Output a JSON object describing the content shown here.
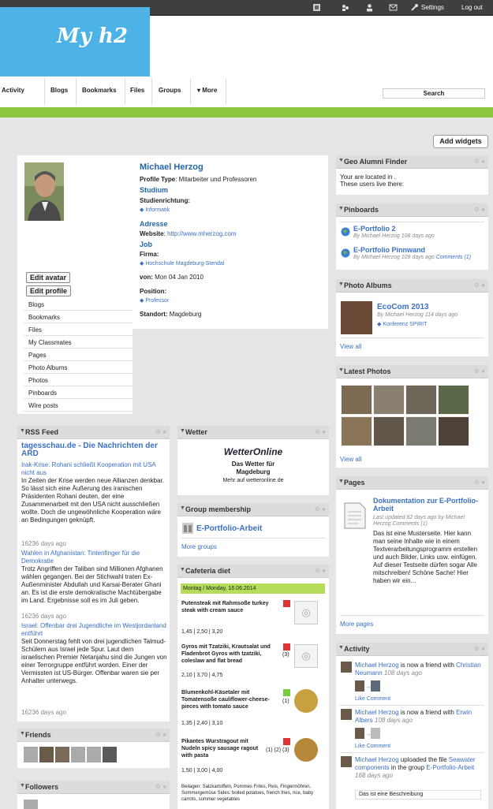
{
  "topbar": {
    "settings": "Settings",
    "logout": "Log out",
    "icons": [
      "dashboard-icon",
      "friends-icon",
      "profile-icon",
      "messages-icon",
      "settings-icon"
    ]
  },
  "logo": "My h2",
  "nav": {
    "items": [
      "Activity",
      "Blogs",
      "Bookmarks",
      "Files",
      "Groups",
      "▾ More"
    ]
  },
  "search": {
    "placeholder": "Search"
  },
  "add_widgets": "Add widgets",
  "profile": {
    "name": "Michael Herzog",
    "profile_type_label": "Profile Type",
    "profile_type": "Mitarbeiter und Professoren",
    "studium": "Studium",
    "studienrichtung_label": "Studienrichtung:",
    "studienrichtung": "Informatik",
    "adresse": "Adresse",
    "website_label": "Website",
    "website": "http://www.mherzog.com",
    "job": "Job",
    "firma_label": "Firma:",
    "firma": "Hochschule Magdeburg-Stendal",
    "von_label": "von:",
    "von": "Mon 04 Jan 2010",
    "position_label": "Position:",
    "position": "Professor",
    "standort_label": "Standort:",
    "standort": "Magdeburg",
    "edit_avatar": "Edit avatar",
    "edit_profile": "Edit profile",
    "menu": [
      "Blogs",
      "Bookmarks",
      "Files",
      "My Classmates",
      "Pages",
      "Photo Albums",
      "Photos",
      "Pinboards",
      "Wire posts"
    ]
  },
  "geo": {
    "title": "Geo Alumni Finder",
    "line1": "Your are located in .",
    "line2": "These users live there:"
  },
  "pinboards": {
    "title": "Pinboards",
    "items": [
      {
        "title": "E-Portfolio 2",
        "meta": "By Michael Herzog 108 days ago"
      },
      {
        "title": "E-Portfolio Pinnwand",
        "meta": "By Michael Herzog 109 days ago",
        "comments": "Comments (1)"
      }
    ]
  },
  "albums": {
    "title": "Photo Albums",
    "item_title": "EcoCom 2013",
    "item_meta": "By Michael Herzog 114 days ago",
    "item_tag": "Konferenz SPiRIT",
    "view_all": "View all"
  },
  "latest_photos": {
    "title": "Latest Photos",
    "view_all": "View all"
  },
  "pages": {
    "title": "Pages",
    "item_title": "Dokumentation zur E-Portfolio-Arbeit",
    "item_meta": "Last updated 82 days ago by Michael Herzog Comments (1)",
    "body": "Das ist eine Musterseite. Hier kann man seine Inhalte wie in einem Textverarbeitungsprogramm erstellen und auch Bilder, Links usw. einfügen. Auf dieser Testseite dürfen sogar Alle mitschreiben! Schöne Sache! Hier haben wir ein...",
    "more": "More pages"
  },
  "activity": {
    "title": "Activity",
    "items": [
      {
        "actor": "Michael Herzog",
        "verb": "is now a friend with",
        "target": "Christian Neumann",
        "time": "108 days ago",
        "actions": "Like Comment"
      },
      {
        "actor": "Michael Herzog",
        "verb": "is now a friend with",
        "target": "Erwin Albers",
        "time": "108 days ago",
        "actions": "Like Comment"
      },
      {
        "actor": "Michael Herzog",
        "verb": "uploaded the file",
        "target": "Seawater components",
        "mid": "in the group",
        "group": "E-Portfolio-Arbeit",
        "time": "168 days ago",
        "desc": "Das ist eine Beschreibung"
      }
    ]
  },
  "rss": {
    "title": "RSS Feed",
    "feed_title": "tagesschau.de - Die Nachrichten der ARD",
    "items": [
      {
        "title": "Irak-Krise: Rohani schließt Kooperation mit USA nicht aus",
        "body": "In Zeiten der Krise werden neue Allianzen denkbar. So lässt sich eine Äußerung des iranischen Präsidenten Rohani deuten, der eine Zusammenarbeit mit den USA nicht ausschließen wollte. Doch die ungewöhnliche Kooperation wäre an Bedingungen geknüpft.",
        "time": "16236 days ago"
      },
      {
        "title": "Wahlen in Afghanistan: Tintenfinger für die Demokratie",
        "body": "Trotz Angriffen der Taliban sind Millionen Afghanen wählen gegangen. Bei der Stichwahl traten Ex-Außenminister Abdullah und Karsai-Berater Ghani an. Es ist die erste demokratische Machtübergabe im Land. Ergebnisse soll es im Juli geben.",
        "time": "16236 days ago"
      },
      {
        "title": "Israel: Offenbar drei Jugendliche im Westjordanland entführt",
        "body": "Seit Donnerstag fehlt von drei jugendlichen Talmud-Schülern aus Israel jede Spur. Laut dem israelischen Premier Netanjahu sind die Jungen von einer Terrorgruppe entführt worden. Einer der Vermissten ist US-Bürger. Offenbar waren sie per Anhalter unterwegs.",
        "time": "16236 days ago"
      }
    ]
  },
  "friends": {
    "title": "Friends"
  },
  "followers": {
    "title": "Followers"
  },
  "wetter": {
    "title": "Wetter",
    "logo": "WetterOnline",
    "line1": "Das Wetter für",
    "line2": "Magdeburg",
    "line3": "Mehr auf wetteronline.de"
  },
  "groups": {
    "title": "Group membership",
    "item": "E-Portfolio-Arbeit",
    "more": "More groups"
  },
  "cafeteria": {
    "title": "Cafeteria diet",
    "date": "Montag / Monday, 16.06.2014",
    "items": [
      {
        "name": "Putensteak mit Rahmsoße turkey steak with cream sauce",
        "price": "1,45 | 2,50 | 3,20",
        "note": ""
      },
      {
        "name": "Gyros mit Tzatziki, Krautsalat und Fladenbrot Gyros with tzatziki, coleslaw and flat bread",
        "price": "2,10 | 3,70 | 4,75",
        "note": "(3)"
      },
      {
        "name": "Blumenkohl-Käsetaler mit Tomatensoße cauliflower-cheese-pieces with tomato sauce",
        "price": "1,35 | 2,40 | 3,10",
        "note": "(1)"
      },
      {
        "name": "Pikantes Wurstragout mit Nudeln spicy sausage ragout with pasta",
        "price": "1,50 | 3,00 | 4,00",
        "note": "(1) (2) (3)"
      }
    ],
    "footer": "Beilagen: Salzkartoffeln, Pommes Frites, Reis, Fingermöhren, Sommergemüse Sides: boiled potatoes, french fries, rice, baby carrots, summer vegetables"
  }
}
